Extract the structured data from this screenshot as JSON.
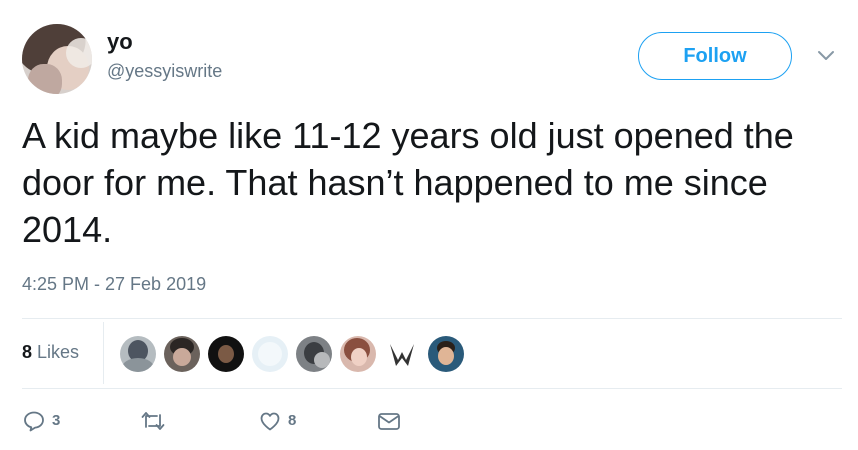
{
  "user": {
    "display_name": "yo",
    "handle": "@yessyiswrite",
    "avatar_icon": "profile-photo"
  },
  "follow_button": {
    "label": "Follow",
    "color": "#1da1f2"
  },
  "menu": {
    "icon": "chevron-down-icon"
  },
  "tweet": {
    "text": "A kid maybe like 11-12 years old just opened the door for me. That hasn’t happened to me since 2014.",
    "timestamp": "4:25 PM - 27 Feb 2019"
  },
  "likes": {
    "count": "8",
    "label": "Likes",
    "liker_avatars": [
      "liker-1",
      "liker-2",
      "liker-3",
      "liker-4",
      "liker-5",
      "liker-6",
      "liker-7",
      "liker-8"
    ]
  },
  "actions": {
    "reply": {
      "icon": "reply-icon",
      "count": "3"
    },
    "retweet": {
      "icon": "retweet-icon",
      "count": ""
    },
    "like": {
      "icon": "heart-icon",
      "count": "8"
    },
    "message": {
      "icon": "envelope-icon",
      "count": ""
    }
  },
  "colors": {
    "text": "#14171a",
    "secondary": "#657786",
    "accent": "#1da1f2",
    "divider": "#e6ecf0"
  }
}
